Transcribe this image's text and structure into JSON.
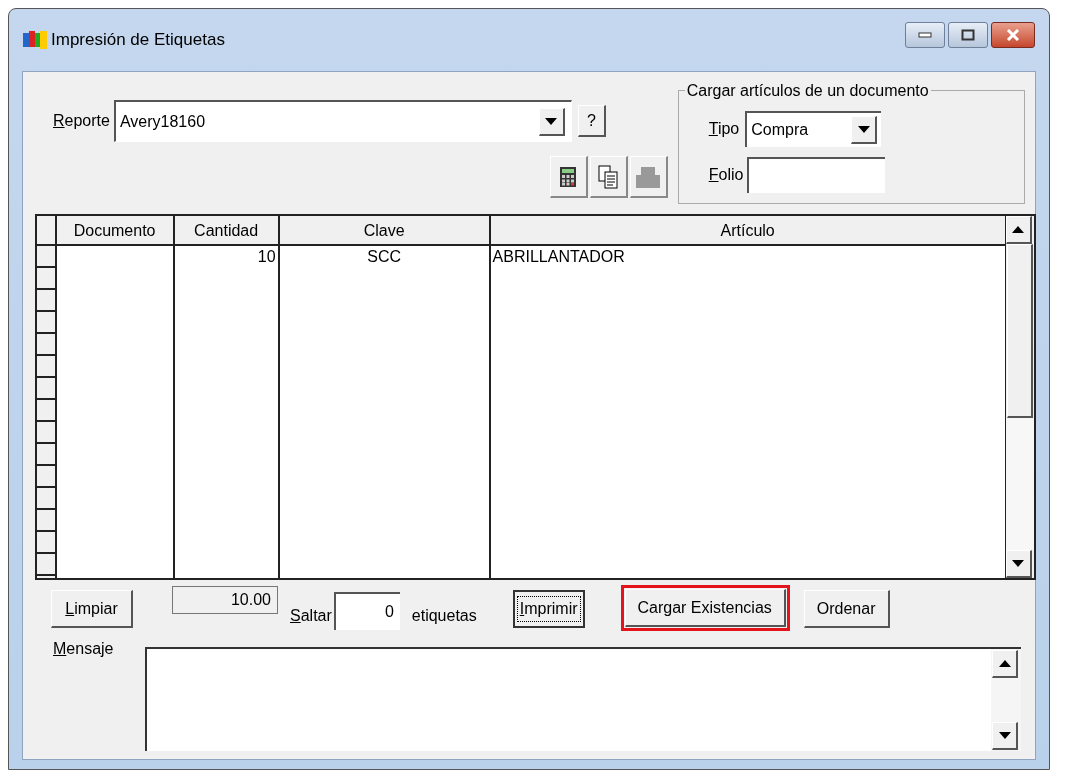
{
  "window": {
    "title": "Impresión de Etiquetas"
  },
  "reporte": {
    "label": "Reporte",
    "value": "Avery18160",
    "help": "?"
  },
  "document_group": {
    "title": "Cargar artículos de un documento",
    "tipo_label": "Tipo",
    "tipo_value": "Compra",
    "folio_label": "Folio"
  },
  "table": {
    "columns": [
      {
        "label": "Documento"
      },
      {
        "label": "Cantidad"
      },
      {
        "label": "Clave"
      },
      {
        "label": "Artículo"
      }
    ],
    "rows": [
      [
        "",
        "10",
        "SCC",
        "ABRILLANTADOR"
      ]
    ]
  },
  "bottom": {
    "limpiar": "Limpiar",
    "total": "10.00",
    "saltar_label": "Saltar",
    "saltar_value": "0",
    "etiquetas": "etiquetas",
    "buttons": [
      {
        "label": "Imprimir",
        "focused": true,
        "highlighted": false
      },
      {
        "label": "Cargar Existencias",
        "focused": false,
        "highlighted": true
      },
      {
        "label": "Ordenar",
        "focused": false,
        "highlighted": false
      }
    ]
  },
  "mensaje": {
    "label": "Mensaje"
  }
}
